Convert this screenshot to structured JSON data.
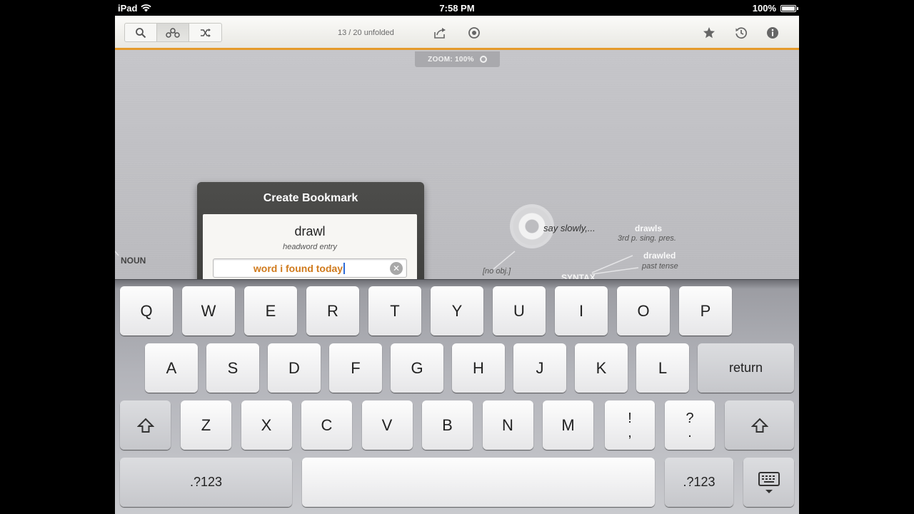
{
  "status_bar": {
    "carrier": "iPad",
    "time": "7:58 PM",
    "battery": "100%",
    "battery_level": 1.0
  },
  "toolbar": {
    "segments": [
      {
        "icon": "search-icon",
        "active": false
      },
      {
        "icon": "graph-icon",
        "active": true
      },
      {
        "icon": "shuffle-icon",
        "active": false
      }
    ],
    "unfold_count": "13 / 20 unfolded",
    "icons": [
      "share-icon",
      "target-icon",
      "star-icon",
      "history-icon",
      "info-icon"
    ],
    "accent_color": "#e59a2b"
  },
  "zoom": {
    "label": "ZOOM: 100%"
  },
  "graph": {
    "noun_label": "NOUN",
    "definition": "say slowly,...",
    "no_obj": "[no obj.]",
    "syntax": "SYNTAX",
    "forms": [
      {
        "word": "drawls",
        "desc": "3rd p. sing. pres."
      },
      {
        "word": "drawled",
        "desc": "past tense"
      }
    ]
  },
  "bookmark": {
    "title": "Create Bookmark",
    "headword": "drawl",
    "headword_sub": "headword entry",
    "input_value": "word i found today"
  },
  "keyboard": {
    "row1": [
      "Q",
      "W",
      "E",
      "R",
      "T",
      "Y",
      "U",
      "I",
      "O",
      "P"
    ],
    "row2": [
      "A",
      "S",
      "D",
      "F",
      "G",
      "H",
      "J",
      "K",
      "L"
    ],
    "row3": [
      "Z",
      "X",
      "C",
      "V",
      "B",
      "N",
      "M"
    ],
    "return_label": "return",
    "numbers_label": ".?123",
    "punct1_top": "!",
    "punct1_bottom": ",",
    "punct2_top": "?",
    "punct2_bottom": "."
  }
}
